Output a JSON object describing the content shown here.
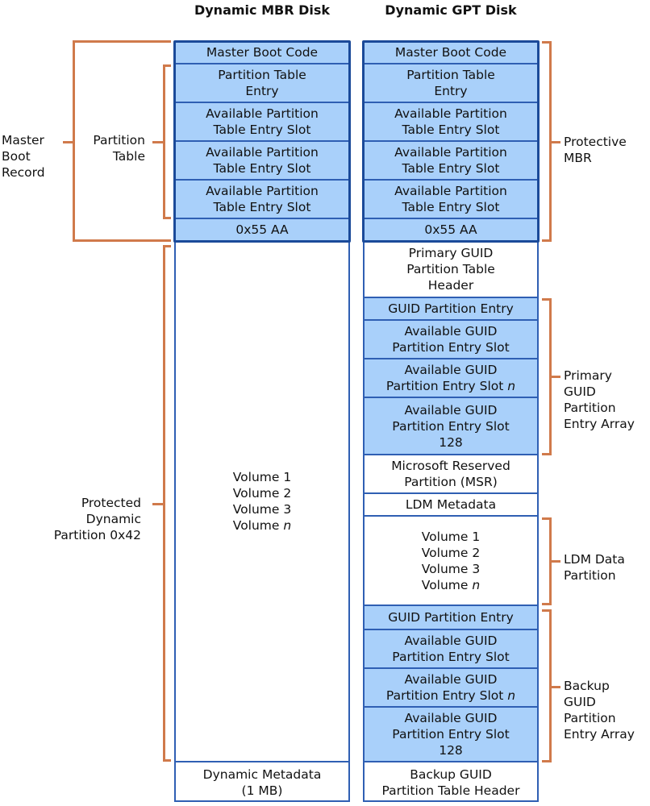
{
  "mbr_disk": {
    "title": "Dynamic MBR\nDisk",
    "cells": [
      {
        "text": "Master Boot Code",
        "fill": "blue"
      },
      {
        "text": "Partition Table\nEntry",
        "fill": "blue"
      },
      {
        "text": "Available Partition\nTable Entry Slot",
        "fill": "blue"
      },
      {
        "text": "Available Partition\nTable Entry Slot",
        "fill": "blue"
      },
      {
        "text": "Available Partition\nTable Entry Slot",
        "fill": "blue"
      },
      {
        "text": "0x55 AA",
        "fill": "blue"
      },
      {
        "text": "Volume 1\nVolume 2\nVolume 3\nVolume  n",
        "fill": "white"
      },
      {
        "text": "Dynamic Metadata\n(1 MB)",
        "fill": "white"
      }
    ]
  },
  "gpt_disk": {
    "title": "Dynamic GPT\nDisk",
    "cells": [
      {
        "text": "Master Boot Code",
        "fill": "blue"
      },
      {
        "text": "Partition Table\nEntry",
        "fill": "blue"
      },
      {
        "text": "Available Partition\nTable Entry Slot",
        "fill": "blue"
      },
      {
        "text": "Available Partition\nTable Entry Slot",
        "fill": "blue"
      },
      {
        "text": "Available Partition\nTable Entry Slot",
        "fill": "blue"
      },
      {
        "text": "0x55 AA",
        "fill": "blue"
      },
      {
        "text": "Primary GUID\nPartition Table\nHeader",
        "fill": "white"
      },
      {
        "text": "GUID Partition Entry",
        "fill": "blue"
      },
      {
        "text": "Available GUID\nPartition Entry Slot",
        "fill": "blue"
      },
      {
        "text": "Available GUID\nPartition Entry Slot  n",
        "fill": "blue"
      },
      {
        "text": "Available GUID\nPartition Entry Slot\n128",
        "fill": "blue"
      },
      {
        "text": "Microsoft Reserved\nPartition (MSR)",
        "fill": "white"
      },
      {
        "text": "LDM Metadata",
        "fill": "white"
      },
      {
        "text": "Volume 1\nVolume 2\nVolume 3\nVolume  n",
        "fill": "white"
      },
      {
        "text": "GUID Partition Entry",
        "fill": "blue"
      },
      {
        "text": "Available GUID\nPartition Entry Slot",
        "fill": "blue"
      },
      {
        "text": "Available GUID\nPartition Entry Slot  n",
        "fill": "blue"
      },
      {
        "text": "Available GUID\nPartition Entry Slot\n128",
        "fill": "blue"
      },
      {
        "text": "Backup GUID\nPartition Table Header",
        "fill": "white"
      }
    ]
  },
  "left_labels": {
    "master_boot_record": "Master\nBoot\nRecord",
    "partition_table": "Partition\nTable",
    "protected_partition": "Protected\nDynamic\nPartition 0x42"
  },
  "right_labels": {
    "protective_mbr": "Protective\nMBR",
    "primary_array": "Primary\nGUID\nPartition\nEntry Array",
    "ldm_data": "LDM Data\nPartition",
    "backup_array": "Backup\nGUID\nPartition\nEntry Array"
  },
  "colors": {
    "cell_blue": "#a9d0fa",
    "border_blue": "#2f5fb3",
    "mbr_border": "#1b4a99",
    "bracket": "#d07a4b"
  }
}
